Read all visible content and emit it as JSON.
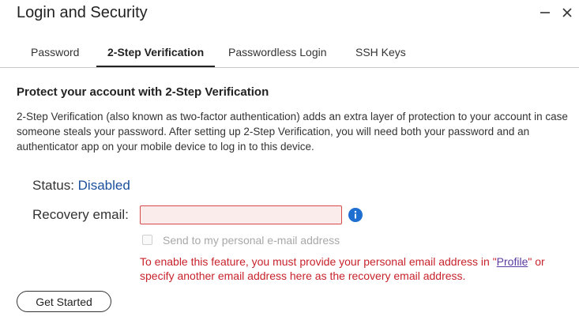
{
  "window": {
    "title": "Login and Security",
    "minimize_icon": "minus-icon",
    "close_icon": "close-icon"
  },
  "tabs": [
    {
      "label": "Password",
      "active": false
    },
    {
      "label": "2-Step Verification",
      "active": true
    },
    {
      "label": "Passwordless Login",
      "active": false
    },
    {
      "label": "SSH Keys",
      "active": false
    }
  ],
  "section": {
    "heading": "Protect your account with 2-Step Verification",
    "description": "2-Step Verification (also known as two-factor authentication) adds an extra layer of protection to your account in case someone steals your password. After setting up 2-Step Verification, you will need both your password and an authenticator app on your mobile device to log in to this device."
  },
  "status": {
    "label": "Status:",
    "value": "Disabled"
  },
  "recovery": {
    "label": "Recovery email:",
    "value": "",
    "placeholder": "",
    "info_icon": "info-icon",
    "checkbox_label": "Send to my personal e-mail address",
    "checkbox_checked": false,
    "error_before": "To enable this feature, you must provide your personal email address in \"",
    "error_link": "Profile",
    "error_after": "\" or specify another email address here as the recovery email address."
  },
  "actions": {
    "get_started": "Get Started"
  },
  "colors": {
    "status_value": "#1a4f9c",
    "error": "#c8232c",
    "info": "#1f6fd1",
    "input_bg": "#fbecec",
    "input_border": "#d44a4a"
  }
}
